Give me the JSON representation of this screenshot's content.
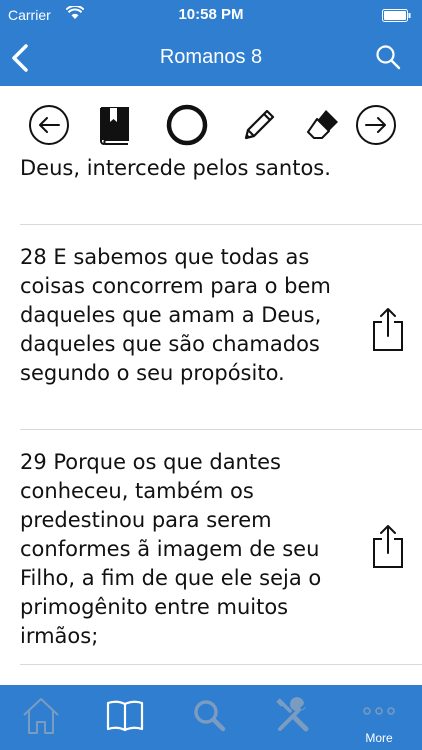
{
  "status_bar": {
    "carrier": "Carrier",
    "time": "10:58 PM"
  },
  "nav": {
    "title": "Romanos 8"
  },
  "toolbar": {
    "icons": [
      "arrow-left-icon",
      "bookmark-book-icon",
      "circle-icon",
      "pencil-icon",
      "eraser-icon",
      "arrow-right-icon"
    ]
  },
  "verses": [
    {
      "text": "Deus, intercede pelos santos."
    },
    {
      "text": "28 E sabemos que todas as coisas concorrem para o bem daqueles que amam a Deus, daqueles que são chamados segundo o seu propósito."
    },
    {
      "text": "29 Porque os que dantes conheceu, também os predestinou para serem conformes ã imagem de seu Filho, a fim de que ele seja o primogênito entre muitos irmãos;"
    }
  ],
  "tabbar": {
    "more_label": "More"
  },
  "colors": {
    "accent": "#2f7ed0",
    "tab_inactive": "#7a9cc0"
  }
}
